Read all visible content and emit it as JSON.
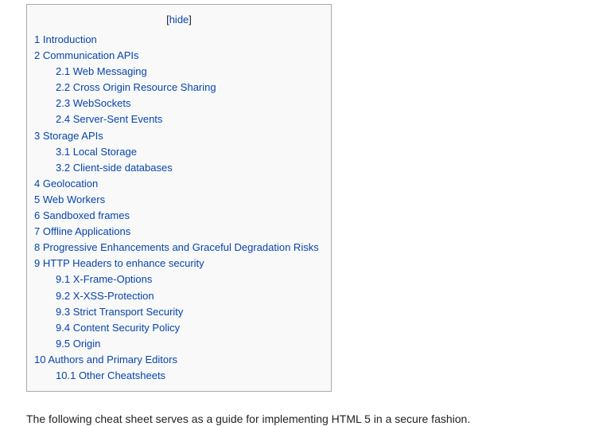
{
  "toc": {
    "toggle": {
      "open_bracket": "[",
      "label": "hide",
      "close_bracket": "]"
    },
    "items": [
      {
        "number": "1",
        "label": "Introduction",
        "level": 1
      },
      {
        "number": "2",
        "label": "Communication APIs",
        "level": 1
      },
      {
        "number": "2.1",
        "label": "Web Messaging",
        "level": 2
      },
      {
        "number": "2.2",
        "label": "Cross Origin Resource Sharing",
        "level": 2
      },
      {
        "number": "2.3",
        "label": "WebSockets",
        "level": 2
      },
      {
        "number": "2.4",
        "label": "Server-Sent Events",
        "level": 2
      },
      {
        "number": "3",
        "label": "Storage APIs",
        "level": 1
      },
      {
        "number": "3.1",
        "label": "Local Storage",
        "level": 2
      },
      {
        "number": "3.2",
        "label": "Client-side databases",
        "level": 2
      },
      {
        "number": "4",
        "label": "Geolocation",
        "level": 1
      },
      {
        "number": "5",
        "label": "Web Workers",
        "level": 1
      },
      {
        "number": "6",
        "label": "Sandboxed frames",
        "level": 1
      },
      {
        "number": "7",
        "label": "Offline Applications",
        "level": 1
      },
      {
        "number": "8",
        "label": "Progressive Enhancements and Graceful Degradation Risks",
        "level": 1
      },
      {
        "number": "9",
        "label": "HTTP Headers to enhance security",
        "level": 1
      },
      {
        "number": "9.1",
        "label": "X-Frame-Options",
        "level": 2
      },
      {
        "number": "9.2",
        "label": "X-XSS-Protection",
        "level": 2
      },
      {
        "number": "9.3",
        "label": "Strict Transport Security",
        "level": 2
      },
      {
        "number": "9.4",
        "label": "Content Security Policy",
        "level": 2
      },
      {
        "number": "9.5",
        "label": "Origin",
        "level": 2
      },
      {
        "number": "10",
        "label": "Authors and Primary Editors",
        "level": 1
      },
      {
        "number": "10.1",
        "label": "Other Cheatsheets",
        "level": 2
      }
    ]
  },
  "intro_text": "The following cheat sheet serves as a guide for implementing HTML 5 in a secure fashion.",
  "colors": {
    "link": "#0645ad",
    "text": "#222222",
    "toc_background": "#f9f9f9",
    "toc_border": "#aaaaaa"
  }
}
